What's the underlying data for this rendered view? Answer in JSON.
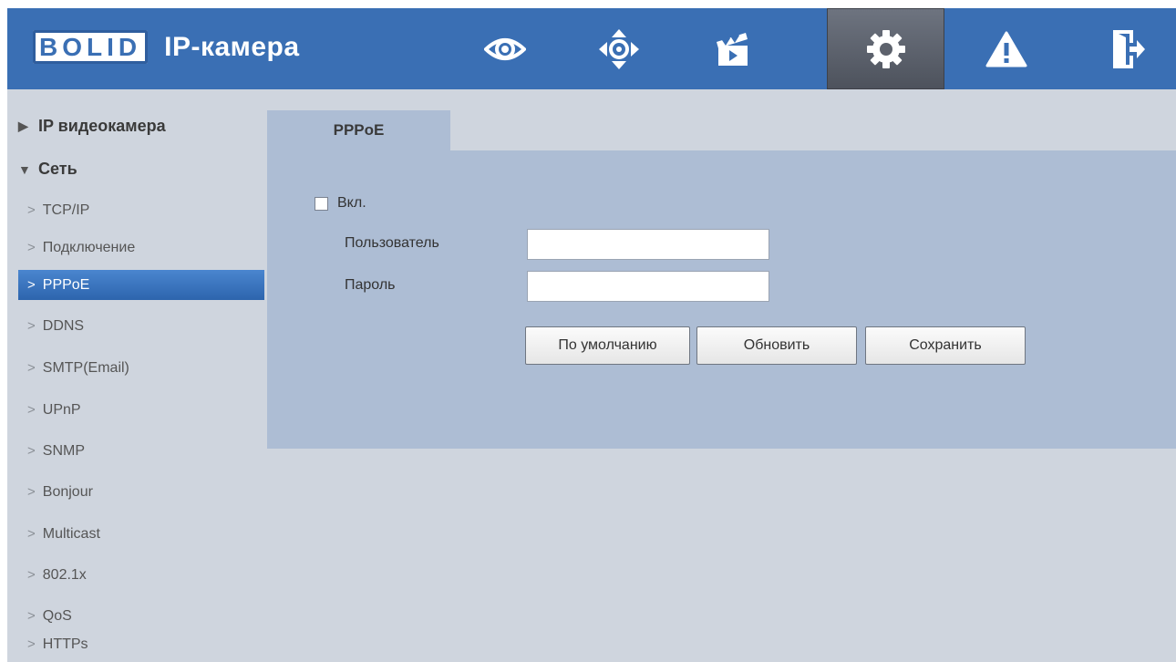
{
  "header": {
    "logo_text": "BOLID",
    "product_name": "IP-камера",
    "nav_icons": [
      "eye-icon",
      "ptz-icon",
      "clapperboard-icon",
      "gear-icon",
      "warning-icon",
      "logout-icon"
    ],
    "active_nav": "gear-icon"
  },
  "sidebar": {
    "group_camera": "IP видеокамера",
    "group_network": "Сеть",
    "items": [
      {
        "label": "TCP/IP"
      },
      {
        "label": "Подключение"
      },
      {
        "label": "PPPoE"
      },
      {
        "label": "DDNS"
      },
      {
        "label": "SMTP(Email)"
      },
      {
        "label": "UPnP"
      },
      {
        "label": "SNMP"
      },
      {
        "label": "Bonjour"
      },
      {
        "label": "Multicast"
      },
      {
        "label": "802.1x"
      },
      {
        "label": "QoS"
      },
      {
        "label": "HTTPs"
      }
    ],
    "active_item": "PPPoE"
  },
  "main": {
    "tab_label": "PPPoE",
    "enable_label": "Вкл.",
    "enable_checked": false,
    "user_label": "Пользователь",
    "user_value": "",
    "password_label": "Пароль",
    "password_value": "",
    "btn_default": "По умолчанию",
    "btn_refresh": "Обновить",
    "btn_save": "Сохранить"
  },
  "colors": {
    "header_bg": "#3a6fb4",
    "content_bg": "#cfd5de",
    "panel_bg": "#adbdd4",
    "active_item": "#3a74bf"
  }
}
